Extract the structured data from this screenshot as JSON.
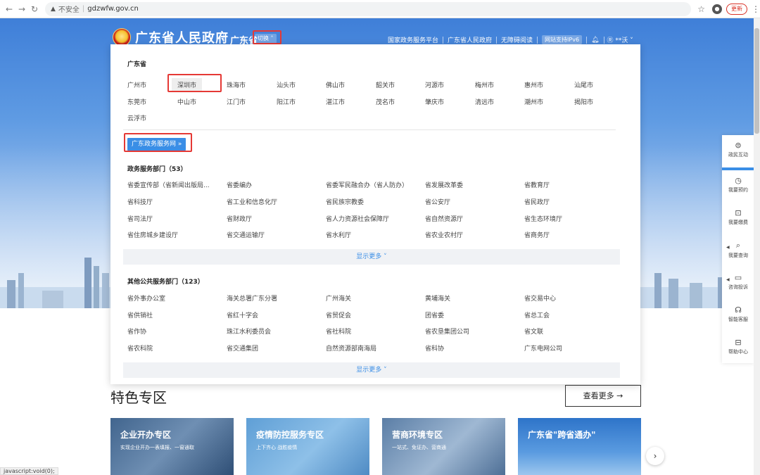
{
  "browser": {
    "security_label": "不安全",
    "url": "gdzwfw.gov.cn",
    "update_label": "更新"
  },
  "header": {
    "title": "广东省人民政府",
    "region": "广东省",
    "switch_label": "切换",
    "links": [
      "国家政务服务平台",
      "广东省人民政府",
      "无障碍阅读"
    ],
    "ipv6_label": "网站支持IPv6",
    "user_label": "**沃"
  },
  "dropdown": {
    "province_title": "广东省",
    "cities": [
      "广州市",
      "深圳市",
      "珠海市",
      "汕头市",
      "佛山市",
      "韶关市",
      "河源市",
      "梅州市",
      "惠州市",
      "汕尾市",
      "东莞市",
      "中山市",
      "江门市",
      "阳江市",
      "湛江市",
      "茂名市",
      "肇庆市",
      "清远市",
      "潮州市",
      "揭阳市",
      "云浮市"
    ],
    "gd_button_label": "广东政务服务网",
    "gov_title": "政务服务部门（53）",
    "gov_depts": [
      "省委宣传部（省新闻出版局...",
      "省委编办",
      "省委军民融合办（省人防办）",
      "省发展改革委",
      "省教育厅",
      "省科技厅",
      "省工业和信息化厅",
      "省民族宗教委",
      "省公安厅",
      "省民政厅",
      "省司法厅",
      "省财政厅",
      "省人力资源社会保障厅",
      "省自然资源厅",
      "省生态环境厅",
      "省住房城乡建设厅",
      "省交通运输厅",
      "省水利厅",
      "省农业农村厅",
      "省商务厅"
    ],
    "show_more_label": "显示更多",
    "public_title": "其他公共服务部门（123）",
    "public_depts": [
      "省外事办公室",
      "海关总署广东分署",
      "广州海关",
      "黄埔海关",
      "省交易中心",
      "省供销社",
      "省红十字会",
      "省贸促会",
      "团省委",
      "省总工会",
      "省作协",
      "珠江水利委员会",
      "省社科院",
      "省农垦集团公司",
      "省文联",
      "省农科院",
      "省交通集团",
      "自然资源部南海局",
      "省科协",
      "广东电网公司"
    ]
  },
  "side_bar": [
    {
      "label": "政民互动",
      "icon": "chat-icon"
    },
    {
      "label": "我要预约",
      "icon": "clock-icon"
    },
    {
      "label": "我要缴费",
      "icon": "payment-icon"
    },
    {
      "label": "我要查询",
      "icon": "search-icon"
    },
    {
      "label": "咨询投诉",
      "icon": "message-icon"
    },
    {
      "label": "智能客服",
      "icon": "headset-icon"
    },
    {
      "label": "帮助中心",
      "icon": "help-icon"
    }
  ],
  "featured": {
    "title": "特色专区",
    "see_more_label": "查看更多 →",
    "cards": [
      {
        "title": "企业开办专区",
        "subtitle": "实现企业开办一表填报、一窗通取"
      },
      {
        "title": "疫情防控服务专区",
        "subtitle": "上下齐心 战胜疫情"
      },
      {
        "title": "营商环境专区",
        "subtitle": "一站式、免证办、营商通"
      },
      {
        "title": "广东省\"跨省通办\"",
        "subtitle": ""
      }
    ]
  },
  "status_text": "javascript:void(0);",
  "colors": {
    "accent": "#3a8ee6",
    "highlight_box": "#e53935"
  }
}
